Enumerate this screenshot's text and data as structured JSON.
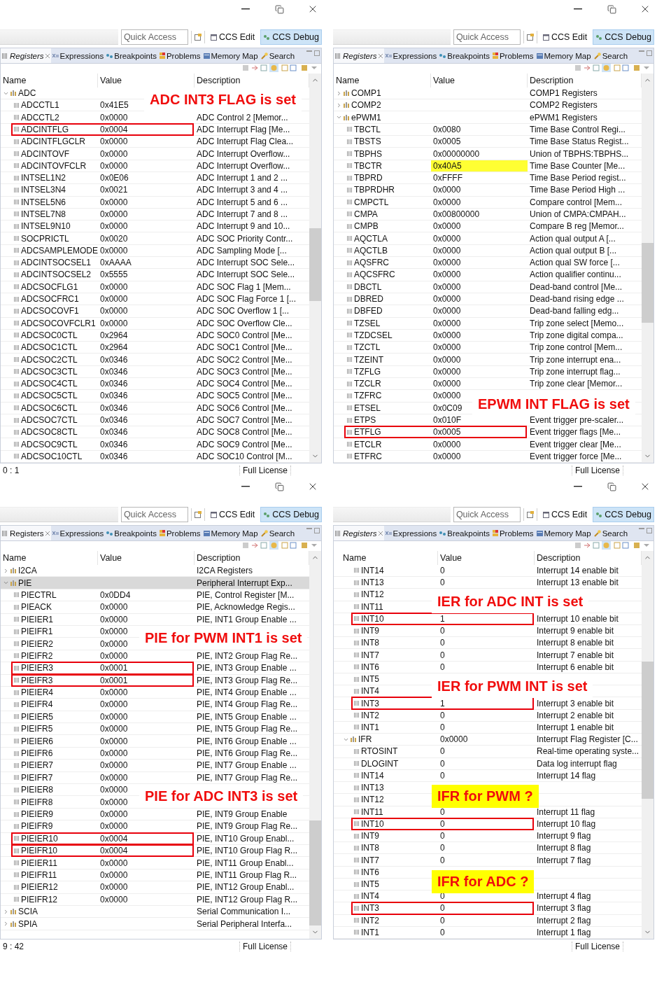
{
  "panels": [
    {
      "quick_access": {
        "placeholder": "Quick Access"
      },
      "perspectives": [
        {
          "label": "CCS Edit",
          "kind": "edit",
          "selected": false
        },
        {
          "label": "CCS Debug",
          "kind": "debug",
          "selected": true
        }
      ],
      "view_focused": true,
      "tabs": [
        {
          "label": "Registers",
          "kind": "registers",
          "selected": true
        },
        {
          "label": "Expressions",
          "kind": "expressions",
          "selected": false
        },
        {
          "label": "Breakpoints",
          "kind": "breakpoints",
          "selected": false
        },
        {
          "label": "Problems",
          "kind": "problems",
          "selected": false
        },
        {
          "label": "Memory Map",
          "kind": "memory",
          "selected": false
        },
        {
          "label": "Search",
          "kind": "search",
          "selected": false
        }
      ],
      "table": {
        "columns": [
          "Name",
          "Value",
          "Description"
        ],
        "rows": [
          {
            "name": "ADC",
            "expanded": true,
            "selected": false,
            "highlighted": false,
            "callout": {
              "text": "ADC INT3 FLAG is set",
              "kind": "label"
            },
            "children": [
              {
                "name": "ADCCTL1",
                "value": "0x41E5",
                "selected": false,
                "highlighted": false
              },
              {
                "name": "ADCCTL2",
                "value": "0x0000",
                "description": "ADC Control 2 [Memor...",
                "selected": false,
                "highlighted": false
              },
              {
                "name": "ADCINTFLG",
                "value": "0x0004",
                "description": "ADC Interrupt Flag [Me...",
                "selected": false,
                "highlighted": true
              },
              {
                "name": "ADCINTFLGCLR",
                "value": "0x0000",
                "description": "ADC Interrupt Flag Clea...",
                "selected": false,
                "highlighted": false
              },
              {
                "name": "ADCINTOVF",
                "value": "0x0000",
                "description": "ADC Interrupt Overflow...",
                "selected": false,
                "highlighted": false
              },
              {
                "name": "ADCINTOVFCLR",
                "value": "0x0000",
                "description": "ADC Interrupt Overflow...",
                "selected": false,
                "highlighted": false
              },
              {
                "name": "INTSEL1N2",
                "value": "0x0E06",
                "description": "ADC Interrupt 1 and 2 ...",
                "selected": false,
                "highlighted": false
              },
              {
                "name": "INTSEL3N4",
                "value": "0x0021",
                "description": "ADC Interrupt 3 and 4 ...",
                "selected": false,
                "highlighted": false
              },
              {
                "name": "INTSEL5N6",
                "value": "0x0000",
                "description": "ADC Interrupt 5 and 6 ...",
                "selected": false,
                "highlighted": false
              },
              {
                "name": "INTSEL7N8",
                "value": "0x0000",
                "description": "ADC Interrupt 7 and 8 ...",
                "selected": false,
                "highlighted": false
              },
              {
                "name": "INTSEL9N10",
                "value": "0x0000",
                "description": "ADC Interrupt 9 and 10...",
                "selected": false,
                "highlighted": false
              },
              {
                "name": "SOCPRICTL",
                "value": "0x0020",
                "description": "ADC SOC Priority Contr...",
                "selected": false,
                "highlighted": false
              },
              {
                "name": "ADCSAMPLEMODE",
                "value": "0x0000",
                "description": "ADC Sampling Mode [...",
                "selected": false,
                "highlighted": false
              },
              {
                "name": "ADCINTSOCSEL1",
                "value": "0xAAAA",
                "description": "ADC Interrupt SOC Sele...",
                "selected": false,
                "highlighted": false
              },
              {
                "name": "ADCINTSOCSEL2",
                "value": "0x5555",
                "description": "ADC Interrupt SOC Sele...",
                "selected": false,
                "highlighted": false
              },
              {
                "name": "ADCSOCFLG1",
                "value": "0x0000",
                "description": "ADC SOC Flag 1 [Mem...",
                "selected": false,
                "highlighted": false
              },
              {
                "name": "ADCSOCFRC1",
                "value": "0x0000",
                "description": "ADC SOC Flag Force 1 [...",
                "selected": false,
                "highlighted": false
              },
              {
                "name": "ADCSOCOVF1",
                "value": "0x0000",
                "description": "ADC SOC Overflow 1 [...",
                "selected": false,
                "highlighted": false
              },
              {
                "name": "ADCSOCOVFCLR1",
                "value": "0x0000",
                "description": "ADC SOC Overflow Cle...",
                "selected": false,
                "highlighted": false
              },
              {
                "name": "ADCSOC0CTL",
                "value": "0x2964",
                "description": "ADC SOC0 Control [Me...",
                "selected": false,
                "highlighted": false
              },
              {
                "name": "ADCSOC1CTL",
                "value": "0x2964",
                "description": "ADC SOC1 Control [Me...",
                "selected": false,
                "highlighted": false
              },
              {
                "name": "ADCSOC2CTL",
                "value": "0x0346",
                "description": "ADC SOC2 Control [Me...",
                "selected": false,
                "highlighted": false
              },
              {
                "name": "ADCSOC3CTL",
                "value": "0x0346",
                "description": "ADC SOC3 Control [Me...",
                "selected": false,
                "highlighted": false
              },
              {
                "name": "ADCSOC4CTL",
                "value": "0x0346",
                "description": "ADC SOC4 Control [Me...",
                "selected": false,
                "highlighted": false
              },
              {
                "name": "ADCSOC5CTL",
                "value": "0x0346",
                "description": "ADC SOC5 Control [Me...",
                "selected": false,
                "highlighted": false
              },
              {
                "name": "ADCSOC6CTL",
                "value": "0x0346",
                "description": "ADC SOC6 Control [Me...",
                "selected": false,
                "highlighted": false
              },
              {
                "name": "ADCSOC7CTL",
                "value": "0x0346",
                "description": "ADC SOC7 Control [Me...",
                "selected": false,
                "highlighted": false
              },
              {
                "name": "ADCSOC8CTL",
                "value": "0x0346",
                "description": "ADC SOC8 Control [Me...",
                "selected": false,
                "highlighted": false
              },
              {
                "name": "ADCSOC9CTL",
                "value": "0x0346",
                "description": "ADC SOC9 Control [Me...",
                "selected": false,
                "highlighted": false
              },
              {
                "name": "ADCSOC10CTL",
                "value": "0x0346",
                "description": "ADC SOC10 Control [M...",
                "selected": false,
                "highlighted": false
              }
            ]
          }
        ]
      },
      "status_bar": {
        "position": "0 : 1",
        "license": "Full License"
      }
    },
    {
      "quick_access": {
        "placeholder": "Quick Access"
      },
      "perspectives": [
        {
          "label": "CCS Edit",
          "kind": "edit",
          "selected": false
        },
        {
          "label": "CCS Debug",
          "kind": "debug",
          "selected": true
        }
      ],
      "view_focused": true,
      "tabs": [
        {
          "label": "Registers",
          "kind": "registers",
          "selected": true
        },
        {
          "label": "Expressions",
          "kind": "expressions",
          "selected": false
        },
        {
          "label": "Breakpoints",
          "kind": "breakpoints",
          "selected": false
        },
        {
          "label": "Problems",
          "kind": "problems",
          "selected": false
        },
        {
          "label": "Memory Map",
          "kind": "memory",
          "selected": false
        },
        {
          "label": "Search",
          "kind": "search",
          "selected": false
        }
      ],
      "table": {
        "columns": [
          "Name",
          "Value",
          "Description"
        ],
        "rows": [
          {
            "name": "COMP1",
            "expanded": false,
            "description": "COMP1 Registers",
            "selected": false,
            "highlighted": false
          },
          {
            "name": "COMP2",
            "expanded": false,
            "description": "COMP2 Registers",
            "selected": false,
            "highlighted": false
          },
          {
            "name": "ePWM1",
            "expanded": true,
            "description": "ePWM1 Registers",
            "selected": false,
            "highlighted": false,
            "children": [
              {
                "name": "TBCTL",
                "value": "0x0080",
                "description": "Time Base Control Regi...",
                "selected": false,
                "highlighted": false,
                "changed": false
              },
              {
                "name": "TBSTS",
                "value": "0x0005",
                "description": "Time Base Status Regist...",
                "selected": false,
                "highlighted": false,
                "changed": false
              },
              {
                "name": "TBPHS",
                "value": "0x00000000",
                "description": "Union of TBPHS:TBPHS...",
                "selected": false,
                "highlighted": false,
                "changed": false
              },
              {
                "name": "TBCTR",
                "value": "0x40A5",
                "description": "Time Base Counter [Me...",
                "selected": false,
                "highlighted": false,
                "changed": true
              },
              {
                "name": "TBPRD",
                "value": "0xFFFF",
                "description": "Time Base Period regist...",
                "selected": false,
                "highlighted": false,
                "changed": false
              },
              {
                "name": "TBPRDHR",
                "value": "0x0000",
                "description": "Time Base Period High ...",
                "selected": false,
                "highlighted": false,
                "changed": false
              },
              {
                "name": "CMPCTL",
                "value": "0x0000",
                "description": "Compare control [Mem...",
                "selected": false,
                "highlighted": false,
                "changed": false
              },
              {
                "name": "CMPA",
                "value": "0x00800000",
                "description": "Union of CMPA:CMPAH...",
                "selected": false,
                "highlighted": false,
                "changed": false
              },
              {
                "name": "CMPB",
                "value": "0x0000",
                "description": "Compare B reg [Memor...",
                "selected": false,
                "highlighted": false,
                "changed": false
              },
              {
                "name": "AQCTLA",
                "value": "0x0000",
                "description": "Action qual output A [...",
                "selected": false,
                "highlighted": false,
                "changed": false
              },
              {
                "name": "AQCTLB",
                "value": "0x0000",
                "description": "Action qual output B [...",
                "selected": false,
                "highlighted": false,
                "changed": false
              },
              {
                "name": "AQSFRC",
                "value": "0x0000",
                "description": "Action qual SW force [...",
                "selected": false,
                "highlighted": false,
                "changed": false
              },
              {
                "name": "AQCSFRC",
                "value": "0x0000",
                "description": "Action qualifier continu...",
                "selected": false,
                "highlighted": false,
                "changed": false
              },
              {
                "name": "DBCTL",
                "value": "0x0000",
                "description": "Dead-band control [Me...",
                "selected": false,
                "highlighted": false,
                "changed": false
              },
              {
                "name": "DBRED",
                "value": "0x0000",
                "description": "Dead-band rising edge ...",
                "selected": false,
                "highlighted": false,
                "changed": false
              },
              {
                "name": "DBFED",
                "value": "0x0000",
                "description": "Dead-band falling edg...",
                "selected": false,
                "highlighted": false,
                "changed": false
              },
              {
                "name": "TZSEL",
                "value": "0x0000",
                "description": "Trip zone select [Memo...",
                "selected": false,
                "highlighted": false,
                "changed": false
              },
              {
                "name": "TZDCSEL",
                "value": "0x0000",
                "description": "Trip zone digital compa...",
                "selected": false,
                "highlighted": false,
                "changed": false
              },
              {
                "name": "TZCTL",
                "value": "0x0000",
                "description": "Trip zone control [Mem...",
                "selected": false,
                "highlighted": false,
                "changed": false
              },
              {
                "name": "TZEINT",
                "value": "0x0000",
                "description": "Trip zone interrupt ena...",
                "selected": false,
                "highlighted": false,
                "changed": false
              },
              {
                "name": "TZFLG",
                "value": "0x0000",
                "description": "Trip zone interrupt flag...",
                "selected": false,
                "highlighted": false,
                "changed": false
              },
              {
                "name": "TZCLR",
                "value": "0x0000",
                "description": "Trip zone clear [Memor...",
                "selected": false,
                "highlighted": false,
                "changed": false
              },
              {
                "name": "TZFRC",
                "value": "0x0000",
                "selected": false,
                "highlighted": false,
                "changed": false,
                "callout": {
                  "text": "EPWM INT FLAG is set",
                  "kind": "label"
                }
              },
              {
                "name": "ETSEL",
                "value": "0x0C09",
                "selected": false,
                "highlighted": false,
                "changed": false
              },
              {
                "name": "ETPS",
                "value": "0x010F",
                "description": "Event trigger pre-scaler...",
                "selected": false,
                "highlighted": false,
                "changed": false
              },
              {
                "name": "ETFLG",
                "value": "0x0005",
                "description": "Event trigger flags [Me...",
                "selected": false,
                "highlighted": true,
                "changed": false
              },
              {
                "name": "ETCLR",
                "value": "0x0000",
                "description": "Event trigger clear [Me...",
                "selected": false,
                "highlighted": false,
                "changed": false
              },
              {
                "name": "ETFRC",
                "value": "0x0000",
                "description": "Event trigger force [Me...",
                "selected": false,
                "highlighted": false,
                "changed": false
              }
            ]
          }
        ]
      },
      "status_bar": {
        "license": "Full License"
      }
    },
    {
      "quick_access": {
        "placeholder": "Quick Access"
      },
      "perspectives": [
        {
          "label": "CCS Edit",
          "kind": "edit",
          "selected": false
        },
        {
          "label": "CCS Debug",
          "kind": "debug",
          "selected": true
        }
      ],
      "view_focused": false,
      "tabs": [
        {
          "label": "Registers",
          "kind": "registers",
          "selected": true
        },
        {
          "label": "Expressions",
          "kind": "expressions",
          "selected": false
        },
        {
          "label": "Breakpoints",
          "kind": "breakpoints",
          "selected": false
        },
        {
          "label": "Problems",
          "kind": "problems",
          "selected": false
        },
        {
          "label": "Memory Map",
          "kind": "memory",
          "selected": false
        },
        {
          "label": "Search",
          "kind": "search",
          "selected": false
        }
      ],
      "table": {
        "columns": [
          "Name",
          "Value",
          "Description"
        ],
        "rows": [
          {
            "name": "I2CA",
            "expanded": false,
            "description": "I2CA Registers",
            "selected": false,
            "highlighted": false
          },
          {
            "name": "PIE",
            "expanded": true,
            "description": "Peripheral Interrupt Exp...",
            "selected": true,
            "highlighted": false,
            "children": [
              {
                "name": "PIECTRL",
                "value": "0x0DD4",
                "description": "PIE, Control Register [M...",
                "selected": false,
                "highlighted": false
              },
              {
                "name": "PIEACK",
                "value": "0x0000",
                "description": "PIE, Acknowledge Regis...",
                "selected": false,
                "highlighted": false
              },
              {
                "name": "PIEIER1",
                "value": "0x0000",
                "description": "PIE, INT1 Group Enable ...",
                "selected": false,
                "highlighted": false
              },
              {
                "name": "PIEIFR1",
                "value": "0x0000",
                "selected": false,
                "highlighted": false,
                "callout": {
                  "text": "PIE for PWM INT1 is set",
                  "kind": "label"
                }
              },
              {
                "name": "PIEIER2",
                "value": "0x0000",
                "selected": false,
                "highlighted": false
              },
              {
                "name": "PIEIFR2",
                "value": "0x0000",
                "description": "PIE, INT2 Group Flag Re...",
                "selected": false,
                "highlighted": false
              },
              {
                "name": "PIEIER3",
                "value": "0x0001",
                "description": "PIE, INT3 Group Enable ...",
                "selected": false,
                "highlighted": true
              },
              {
                "name": "PIEIFR3",
                "value": "0x0001",
                "description": "PIE, INT3 Group Flag Re...",
                "selected": false,
                "highlighted": true
              },
              {
                "name": "PIEIER4",
                "value": "0x0000",
                "description": "PIE, INT4 Group Enable ...",
                "selected": false,
                "highlighted": false
              },
              {
                "name": "PIEIFR4",
                "value": "0x0000",
                "description": "PIE, INT4 Group Flag Re...",
                "selected": false,
                "highlighted": false
              },
              {
                "name": "PIEIER5",
                "value": "0x0000",
                "description": "PIE, INT5 Group Enable ...",
                "selected": false,
                "highlighted": false
              },
              {
                "name": "PIEIFR5",
                "value": "0x0000",
                "description": "PIE, INT5 Group Flag Re...",
                "selected": false,
                "highlighted": false
              },
              {
                "name": "PIEIER6",
                "value": "0x0000",
                "description": "PIE, INT6 Group Enable ...",
                "selected": false,
                "highlighted": false
              },
              {
                "name": "PIEIFR6",
                "value": "0x0000",
                "description": "PIE, INT6 Group Flag Re...",
                "selected": false,
                "highlighted": false
              },
              {
                "name": "PIEIER7",
                "value": "0x0000",
                "description": "PIE, INT7 Group Enable ...",
                "selected": false,
                "highlighted": false
              },
              {
                "name": "PIEIFR7",
                "value": "0x0000",
                "description": "PIE, INT7 Group Flag Re...",
                "selected": false,
                "highlighted": false
              },
              {
                "name": "PIEIER8",
                "value": "0x0000",
                "selected": false,
                "highlighted": false,
                "callout": {
                  "text": "PIE for ADC INT3 is set",
                  "kind": "label"
                }
              },
              {
                "name": "PIEIFR8",
                "value": "0x0000",
                "selected": false,
                "highlighted": false
              },
              {
                "name": "PIEIER9",
                "value": "0x0000",
                "description": "PIE, INT9 Group Enable",
                "selected": false,
                "highlighted": false
              },
              {
                "name": "PIEIFR9",
                "value": "0x0000",
                "description": "PIE, INT9 Group Flag Re...",
                "selected": false,
                "highlighted": false
              },
              {
                "name": "PIEIER10",
                "value": "0x0004",
                "description": "PIE, INT10 Group Enabl...",
                "selected": false,
                "highlighted": true
              },
              {
                "name": "PIEIFR10",
                "value": "0x0004",
                "description": "PIE, INT10 Group Flag R...",
                "selected": false,
                "highlighted": true
              },
              {
                "name": "PIEIER11",
                "value": "0x0000",
                "description": "PIE, INT11 Group Enabl...",
                "selected": false,
                "highlighted": false
              },
              {
                "name": "PIEIFR11",
                "value": "0x0000",
                "description": "PIE, INT11 Group Flag R...",
                "selected": false,
                "highlighted": false
              },
              {
                "name": "PIEIER12",
                "value": "0x0000",
                "description": "PIE, INT12 Group Enabl...",
                "selected": false,
                "highlighted": false
              },
              {
                "name": "PIEIFR12",
                "value": "0x0000",
                "description": "PIE, INT12 Group Flag R...",
                "selected": false,
                "highlighted": false
              }
            ]
          },
          {
            "name": "SCIA",
            "expanded": false,
            "description": "Serial Communication I...",
            "selected": false,
            "highlighted": false
          },
          {
            "name": "SPIA",
            "expanded": false,
            "description": "Serial Peripheral Interfa...",
            "selected": false,
            "highlighted": false
          }
        ]
      },
      "status_bar": {
        "position": "9 : 42",
        "license": "Full License"
      }
    },
    {
      "quick_access": {
        "placeholder": "Quick Access"
      },
      "perspectives": [
        {
          "label": "CCS Edit",
          "kind": "edit",
          "selected": false
        },
        {
          "label": "CCS Debug",
          "kind": "debug",
          "selected": true
        }
      ],
      "view_focused": true,
      "tabs": [
        {
          "label": "Registers",
          "kind": "registers",
          "selected": true
        },
        {
          "label": "Expressions",
          "kind": "expressions",
          "selected": false
        },
        {
          "label": "Breakpoints",
          "kind": "breakpoints",
          "selected": false
        },
        {
          "label": "Problems",
          "kind": "problems",
          "selected": false
        },
        {
          "label": "Memory Map",
          "kind": "memory",
          "selected": false
        },
        {
          "label": "Search",
          "kind": "search",
          "selected": false
        }
      ],
      "table": {
        "columns": [
          "Name",
          "Value",
          "Description"
        ],
        "rows": [
          {
            "children": [
              {
                "name": "INT14",
                "value": "0",
                "description": "Interrupt 14 enable bit",
                "selected": false,
                "highlighted": false
              },
              {
                "name": "INT13",
                "value": "0",
                "description": "Interrupt 13 enable bit",
                "selected": false,
                "highlighted": false
              },
              {
                "name": "INT12",
                "selected": false,
                "highlighted": false,
                "callout": {
                  "text": "IER for ADC INT is set",
                  "kind": "label"
                }
              },
              {
                "name": "INT11",
                "selected": false,
                "highlighted": false
              },
              {
                "name": "INT10",
                "value": "1",
                "description": "Interrupt 10 enable bit",
                "selected": false,
                "highlighted": true
              },
              {
                "name": "INT9",
                "value": "0",
                "description": "Interrupt 9 enable bit",
                "selected": false,
                "highlighted": false
              },
              {
                "name": "INT8",
                "value": "0",
                "description": "Interrupt 8 enable bit",
                "selected": false,
                "highlighted": false
              },
              {
                "name": "INT7",
                "value": "0",
                "description": "Interrupt 7 enable bit",
                "selected": false,
                "highlighted": false
              },
              {
                "name": "INT6",
                "value": "0",
                "description": "Interrupt 6 enable bit",
                "selected": false,
                "highlighted": false
              },
              {
                "name": "INT5",
                "selected": false,
                "highlighted": false,
                "callout": {
                  "text": "IER for PWM INT is set",
                  "kind": "label"
                }
              },
              {
                "name": "INT4",
                "selected": false,
                "highlighted": false
              },
              {
                "name": "INT3",
                "value": "1",
                "description": "Interrupt 3 enable bit",
                "selected": false,
                "highlighted": true
              },
              {
                "name": "INT2",
                "value": "0",
                "description": "Interrupt 2 enable bit",
                "selected": false,
                "highlighted": false
              },
              {
                "name": "INT1",
                "value": "0",
                "description": "Interrupt 1 enable bit",
                "selected": false,
                "highlighted": false
              }
            ]
          },
          {
            "name": "IFR",
            "expanded": true,
            "value": "0x0000",
            "description": "Interrupt Flag Register [C...",
            "selected": false,
            "highlighted": false,
            "children": [
              {
                "name": "RTOSINT",
                "value": "0",
                "description": "Real-time operating syste...",
                "selected": false,
                "highlighted": false
              },
              {
                "name": "DLOGINT",
                "value": "0",
                "description": "Data log interrupt flag",
                "selected": false,
                "highlighted": false
              },
              {
                "name": "INT14",
                "value": "0",
                "description": "Interrupt 14 flag",
                "selected": false,
                "highlighted": false
              },
              {
                "name": "INT13",
                "selected": false,
                "highlighted": false,
                "callout": {
                  "text": "IFR for PWM ?",
                  "kind": "question"
                }
              },
              {
                "name": "INT12",
                "selected": false,
                "highlighted": false
              },
              {
                "name": "INT11",
                "value": "0",
                "description": "Interrupt 11 flag",
                "selected": false,
                "highlighted": false
              },
              {
                "name": "INT10",
                "value": "0",
                "description": "Interrupt 10 flag",
                "selected": false,
                "highlighted": true
              },
              {
                "name": "INT9",
                "value": "0",
                "description": "Interrupt 9 flag",
                "selected": false,
                "highlighted": false
              },
              {
                "name": "INT8",
                "value": "0",
                "description": "Interrupt 8 flag",
                "selected": false,
                "highlighted": false
              },
              {
                "name": "INT7",
                "value": "0",
                "description": "Interrupt 7 flag",
                "selected": false,
                "highlighted": false
              },
              {
                "name": "INT6",
                "selected": false,
                "highlighted": false,
                "callout": {
                  "text": "IFR for ADC ?",
                  "kind": "question"
                }
              },
              {
                "name": "INT5",
                "selected": false,
                "highlighted": false
              },
              {
                "name": "INT4",
                "value": "0",
                "description": "Interrupt 4 flag",
                "selected": false,
                "highlighted": false
              },
              {
                "name": "INT3",
                "value": "0",
                "description": "Interrupt 3 flag",
                "selected": false,
                "highlighted": true
              },
              {
                "name": "INT2",
                "value": "0",
                "description": "Interrupt 2 flag",
                "selected": false,
                "highlighted": false
              },
              {
                "name": "INT1",
                "value": "0",
                "description": "Interrupt 1 flag",
                "selected": false,
                "highlighted": false
              }
            ]
          }
        ]
      },
      "status_bar": {
        "license": "Full License"
      }
    }
  ]
}
